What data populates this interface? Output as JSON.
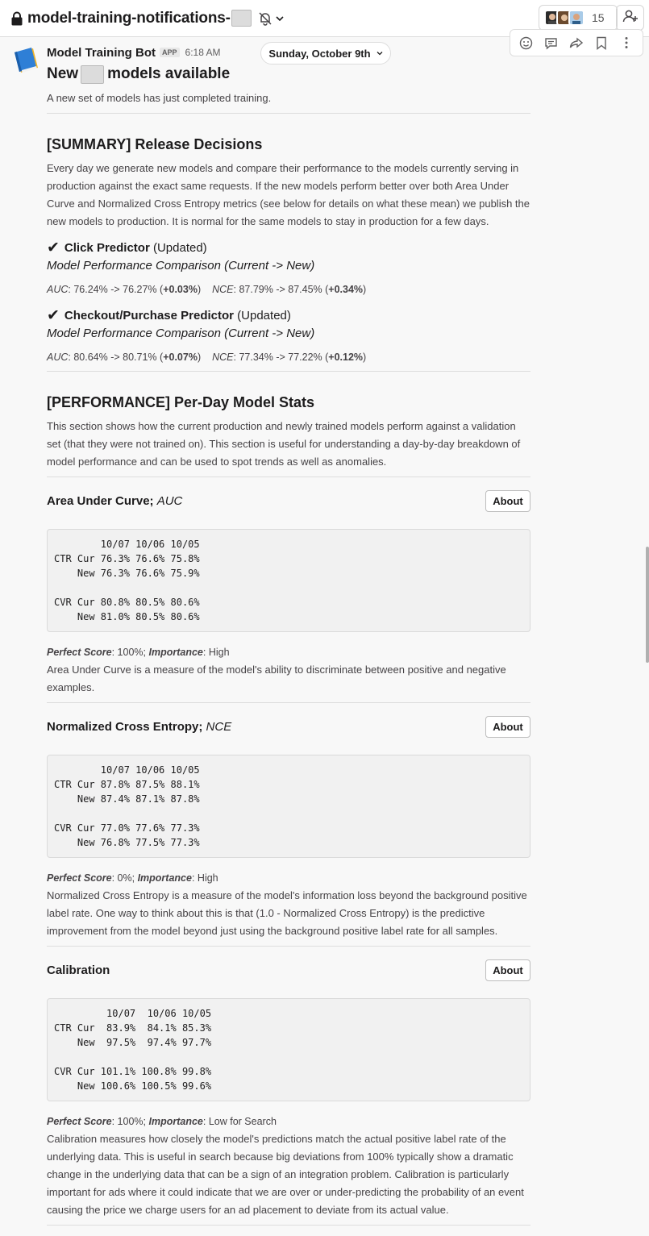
{
  "header": {
    "channel_name": "model-training-notifications-",
    "member_count": "15"
  },
  "date_pill": "Sunday, October 9th",
  "message": {
    "sender": "Model Training Bot",
    "app_badge": "APP",
    "time": "6:18 AM",
    "title_prefix": "New",
    "title_suffix": "models available",
    "intro": "A new set of models has just completed training."
  },
  "summary": {
    "heading": "[SUMMARY] Release Decisions",
    "body": "Every day we generate new models and compare their performance to the models currently serving in production against the exact same requests. If the new models perform better over both Area Under Curve and Normalized Cross Entropy metrics (see below for details on what these mean) we publish the new models to production. It is normal for the same models to stay in production for a few days.",
    "predictors": [
      {
        "check": "✔",
        "name": "Click Predictor",
        "status": "(Updated)",
        "compare_label": "Model Performance Comparison (Current -> New)",
        "auc_label": "AUC",
        "auc_text": ": 76.24% -> 76.27% (",
        "auc_delta": "+0.03%",
        "nce_label": "NCE",
        "nce_text": ": 87.79% -> 87.45% (",
        "nce_delta": "+0.34%"
      },
      {
        "check": "✔",
        "name": "Checkout/Purchase Predictor",
        "status": "(Updated)",
        "compare_label": "Model Performance Comparison (Current -> New)",
        "auc_label": "AUC",
        "auc_text": ": 80.64% -> 80.71% (",
        "auc_delta": "+0.07%",
        "nce_label": "NCE",
        "nce_text": ": 77.34% -> 77.22% (",
        "nce_delta": "+0.12%"
      }
    ]
  },
  "performance": {
    "heading": "[PERFORMANCE] Per-Day Model Stats",
    "body": "This section shows how the current production and newly trained models perform against a validation set (that they were not trained on). This section is useful for understanding a day-by-day breakdown of model performance and can be used to spot trends as well as anomalies.",
    "metrics": [
      {
        "name": "Area Under Curve",
        "abbr": "AUC",
        "about_label": "About",
        "table": "        10/07 10/06 10/05\nCTR Cur 76.3% 76.6% 75.8%\n    New 76.3% 76.6% 75.9%\n\nCVR Cur 80.8% 80.5% 80.6%\n    New 81.0% 80.5% 80.6%",
        "perfect_label": "Perfect Score",
        "perfect_value": ": 100%; ",
        "importance_label": "Importance",
        "importance_value": ": High",
        "description": "Area Under Curve is a measure of the model's ability to discriminate between positive and negative examples."
      },
      {
        "name": "Normalized Cross Entropy",
        "abbr": "NCE",
        "about_label": "About",
        "table": "        10/07 10/06 10/05\nCTR Cur 87.8% 87.5% 88.1%\n    New 87.4% 87.1% 87.8%\n\nCVR Cur 77.0% 77.6% 77.3%\n    New 76.8% 77.5% 77.3%",
        "perfect_label": "Perfect Score",
        "perfect_value": ": 0%; ",
        "importance_label": "Importance",
        "importance_value": ": High",
        "description": "Normalized Cross Entropy is a measure of the model's information loss beyond the background positive label rate. One way to think about this is that (1.0 - Normalized Cross Entropy) is the predictive improvement from the model beyond just using the background positive label rate for all samples."
      },
      {
        "name": "Calibration",
        "abbr": "",
        "about_label": "About",
        "table": "         10/07  10/06 10/05\nCTR Cur  83.9%  84.1% 85.3%\n    New  97.5%  97.4% 97.7%\n\nCVR Cur 101.1% 100.8% 99.8%\n    New 100.6% 100.5% 99.6%",
        "perfect_label": "Perfect Score",
        "perfect_value": ": 100%; ",
        "importance_label": "Importance",
        "importance_value": ": Low for Search",
        "description": "Calibration measures how closely the model's predictions match the actual positive label rate of the underlying data. This is useful in search because big deviations from 100% typically show a dramatic change in the underlying data that can be a sign of an integration problem. Calibration is particularly important for ads where it could indicate that we are over or under-predicting the probability of an event causing the price we charge users for an ad placement to deviate from its actual value."
      }
    ]
  }
}
